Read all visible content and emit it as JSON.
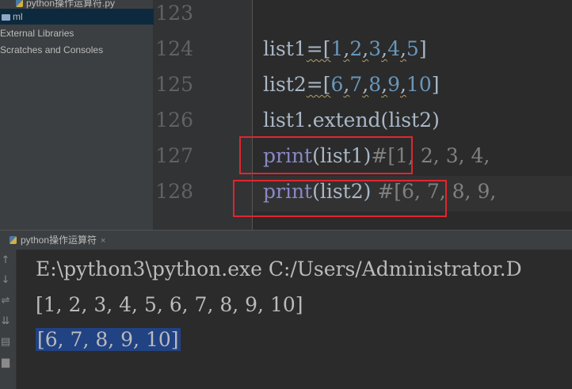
{
  "project_tree": {
    "items": [
      {
        "label": "python操作运算符.py"
      },
      {
        "label": "ml"
      },
      {
        "label": "External Libraries"
      },
      {
        "label": "Scratches and Consoles"
      }
    ]
  },
  "editor": {
    "line_numbers": [
      "123",
      "124",
      "125",
      "126",
      "127",
      "128"
    ],
    "lines": {
      "l124": {
        "var": "list1",
        "op": "=[",
        "n1": "1",
        "n2": "2",
        "n3": "3",
        "n4": "4",
        "n5": "5",
        "close": "]",
        "sep": ","
      },
      "l125": {
        "var": "list2",
        "op": "=[",
        "n1": "6",
        "n2": "7",
        "n3": "8",
        "n4": "9",
        "n5": "10",
        "close": "]",
        "sep": ","
      },
      "l126": {
        "text": "list1.extend(list2)"
      },
      "l127": {
        "fn": "print",
        "args": "(list1)",
        "comment": "#[1, 2, 3, 4,"
      },
      "l128": {
        "fn": "print",
        "args": "(list2) ",
        "comment": "#[6, 7, 8, 9,"
      }
    }
  },
  "run_panel": {
    "tab_label": "python操作运算符",
    "close_symbol": "×",
    "console_lines": [
      "E:\\python3\\python.exe C:/Users/Administrator.D",
      "[1, 2, 3, 4, 5, 6, 7, 8, 9, 10]",
      "[6, 7, 8, 9, 10]"
    ]
  },
  "colors": {
    "highlight_box": "#e0262f",
    "selection": "#214283",
    "number": "#6897bb",
    "builtin": "#8888c6",
    "comment": "#808080"
  }
}
